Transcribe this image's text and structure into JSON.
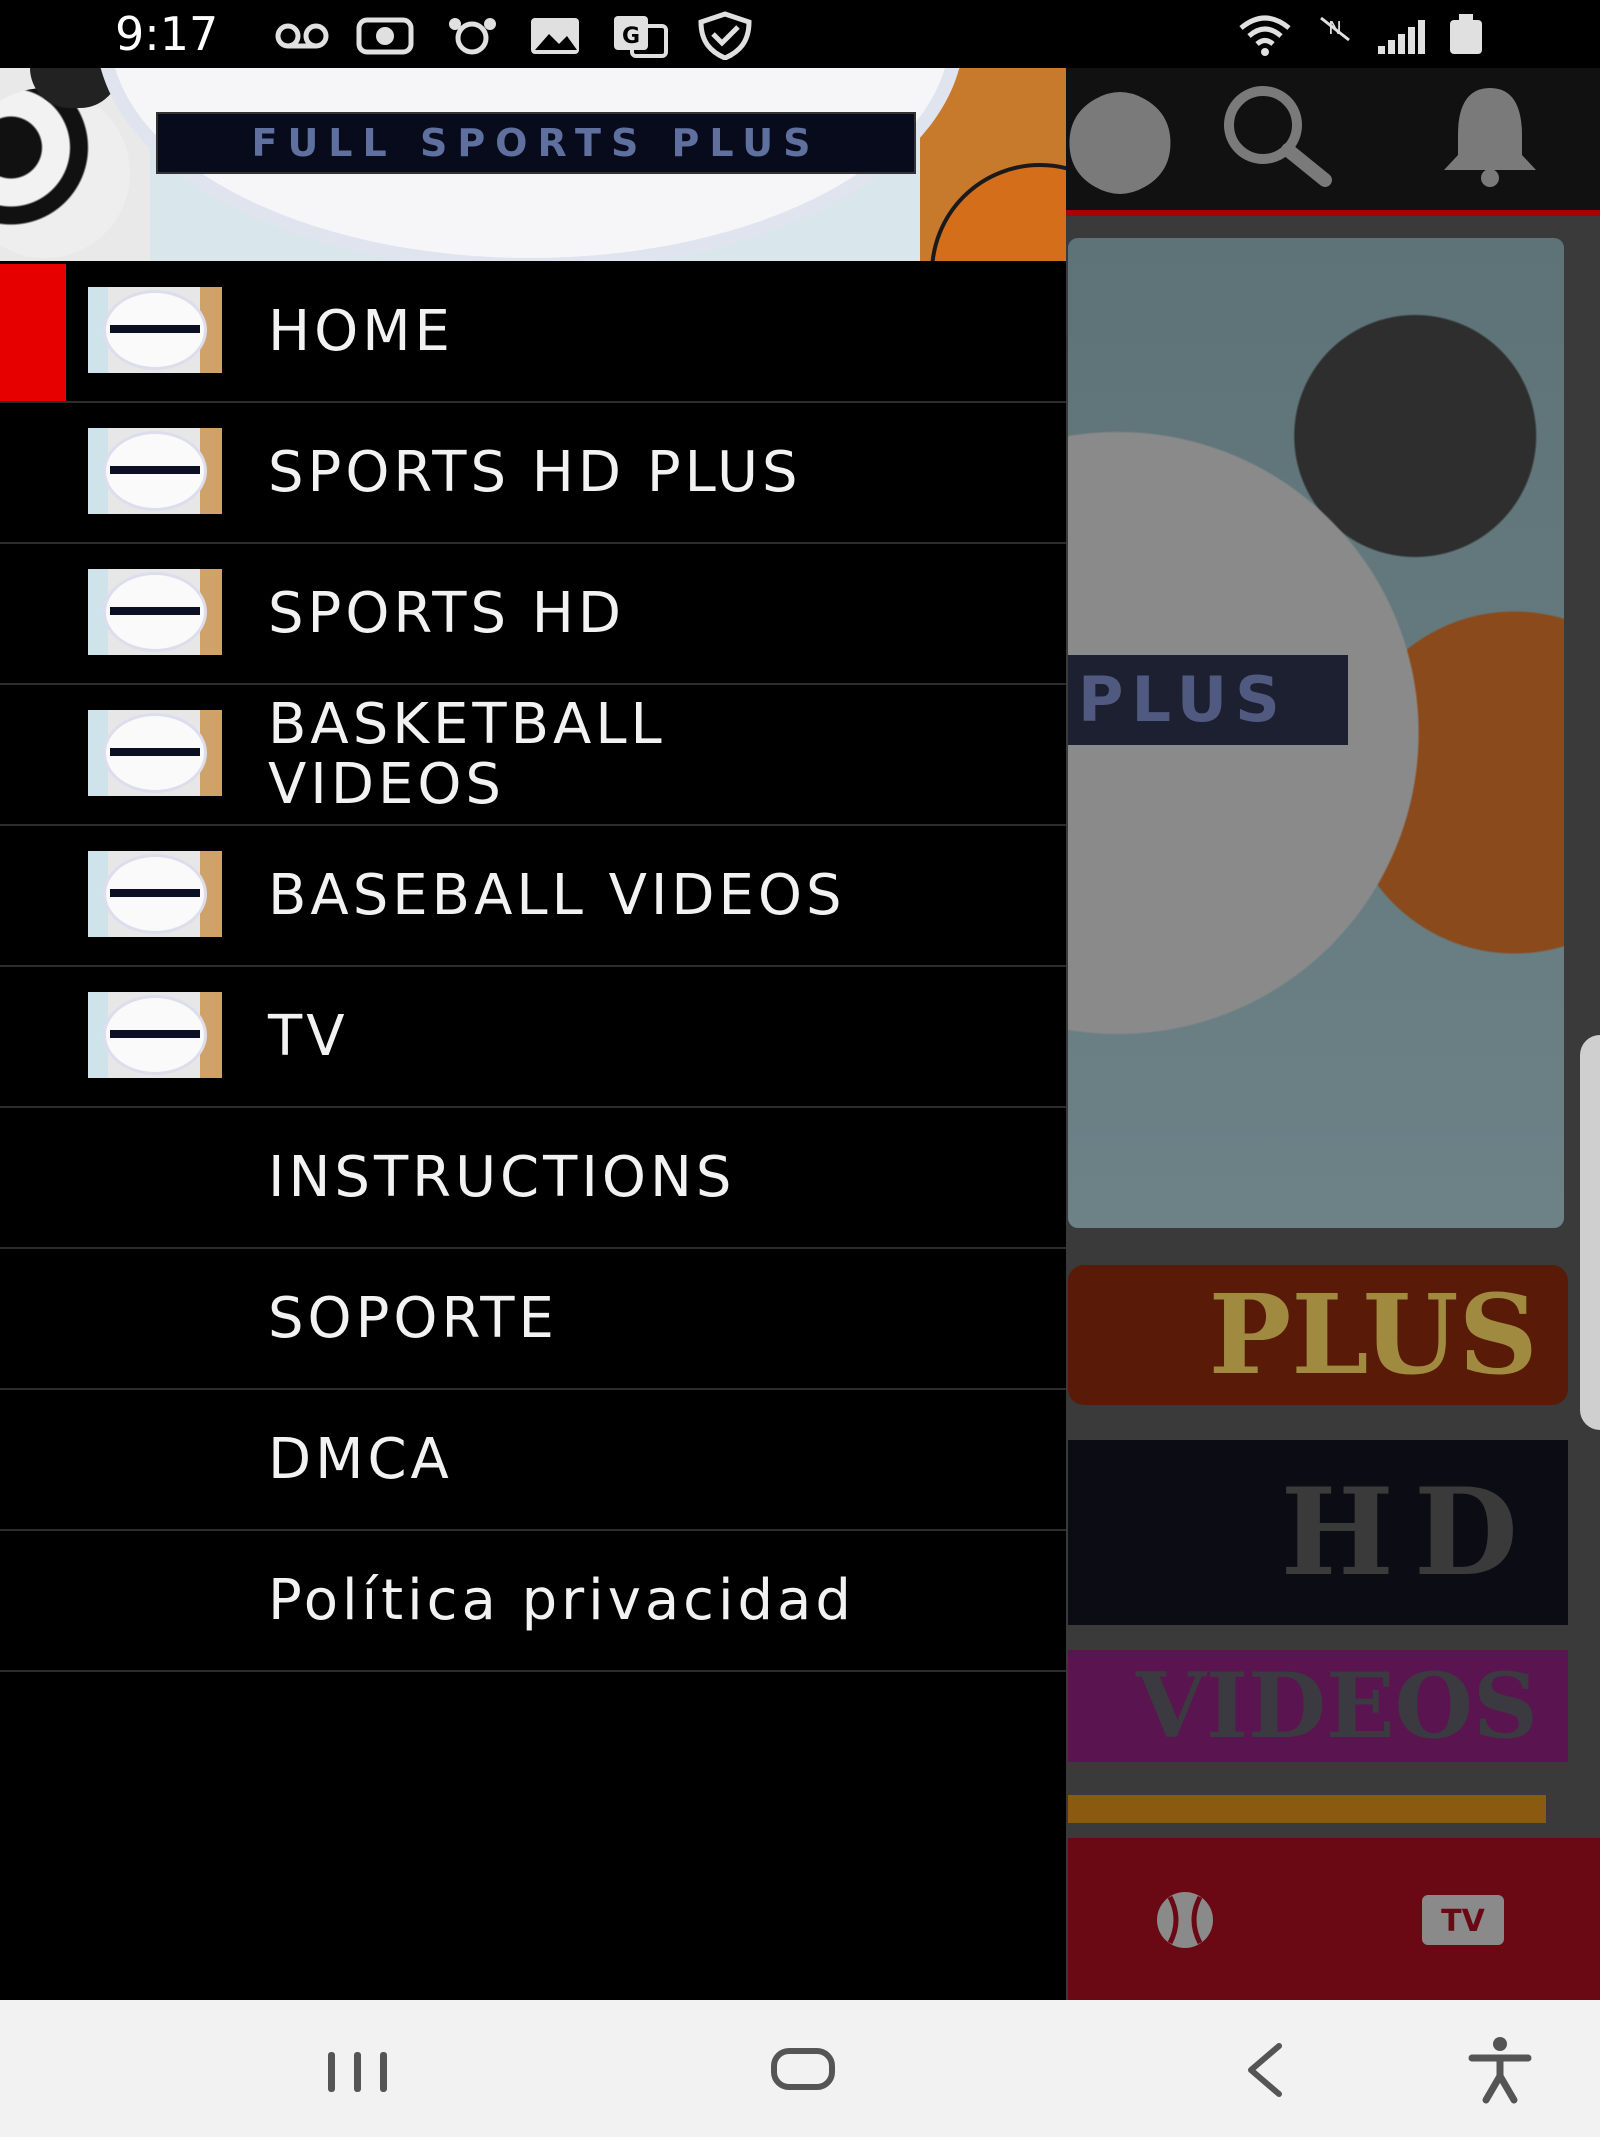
{
  "status_bar": {
    "time": "9:17",
    "left_icons": [
      "voicemail-icon",
      "camera-lens-icon",
      "dog-face-icon",
      "image-icon",
      "translate-icon",
      "shield-check-icon"
    ],
    "right_icons": [
      "wifi-icon",
      "no-data-icon",
      "signal-icon",
      "battery-icon"
    ]
  },
  "drawer": {
    "header_logo_text": "FULL SPORTS PLUS",
    "active_index": 0,
    "active_color": "#e70000",
    "items": [
      {
        "label": "HOME",
        "has_icon": true
      },
      {
        "label": "SPORTS HD PLUS",
        "has_icon": true
      },
      {
        "label": "SPORTS HD",
        "has_icon": true
      },
      {
        "label": "BASKETBALL VIDEOS",
        "has_icon": true
      },
      {
        "label": "BASEBALL VIDEOS",
        "has_icon": true
      },
      {
        "label": "TV",
        "has_icon": true
      },
      {
        "label": "INSTRUCTIONS",
        "has_icon": false
      },
      {
        "label": "SOPORTE",
        "has_icon": false
      },
      {
        "label": "DMCA",
        "has_icon": false
      },
      {
        "label": "Política privacidad",
        "has_icon": false
      }
    ]
  },
  "background_app": {
    "toolbar_icons": [
      "share-icon",
      "search-icon",
      "bell-icon"
    ],
    "hero_text": "PLUS",
    "cards": [
      "PLUS",
      "HD",
      "VIDEOS"
    ],
    "bottom_bar_icons": [
      "baseball-icon",
      "tv-icon"
    ],
    "tv_badge": "TV",
    "accent_color": "#a00000"
  },
  "system_nav": {
    "buttons": [
      "recents-button",
      "home-button",
      "back-button",
      "accessibility-button"
    ]
  }
}
